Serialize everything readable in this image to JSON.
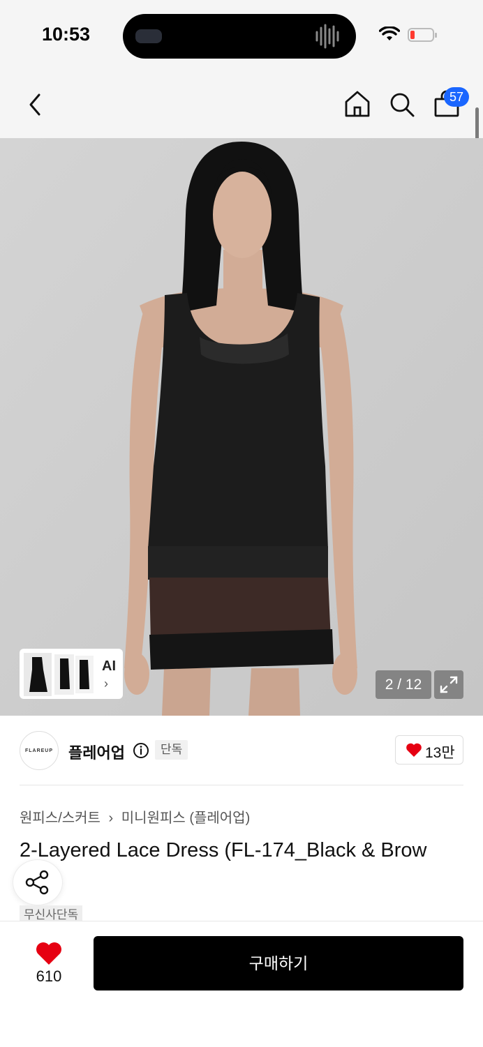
{
  "status_bar": {
    "time": "10:53"
  },
  "nav": {
    "cart_count": "57"
  },
  "image": {
    "counter": "2 / 12",
    "ai_label": "AI"
  },
  "brand": {
    "logo_text": "FLAREUP",
    "name": "플레어업",
    "exclusive_tag": "단독",
    "likes": "13만"
  },
  "breadcrumb": {
    "category": "원피스/스커트",
    "subcategory": "미니원피스 (플레어업)"
  },
  "product": {
    "title": "2-Layered Lace Dress (FL-174_Black & Brow",
    "tag": "무신사단독"
  },
  "bottom_bar": {
    "wish_count": "610",
    "buy_label": "구매하기"
  },
  "colors": {
    "accent": "#1a66ff",
    "heart": "#e60012",
    "buy_bg": "#000000"
  }
}
